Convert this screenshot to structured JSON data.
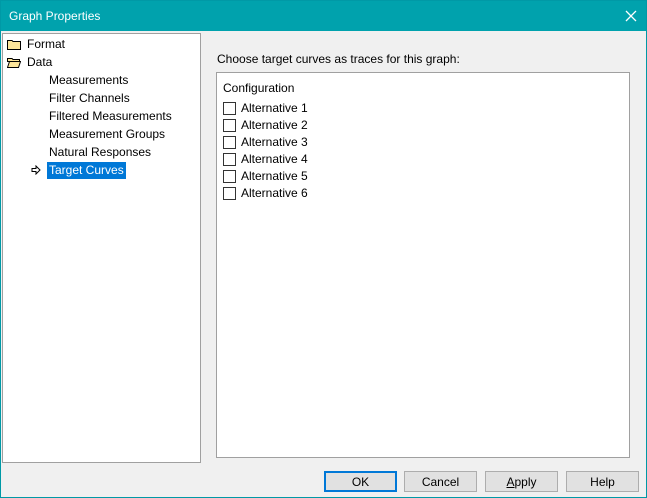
{
  "window": {
    "title": "Graph Properties",
    "accent_color": "#00a2ad"
  },
  "tree": {
    "root_items": [
      {
        "label": "Format",
        "icon": "folder-icon"
      },
      {
        "label": "Data",
        "icon": "folder-open-icon"
      }
    ],
    "children": [
      {
        "label": "Measurements"
      },
      {
        "label": "Filter Channels"
      },
      {
        "label": "Filtered Measurements"
      },
      {
        "label": "Measurement Groups"
      },
      {
        "label": "Natural Responses"
      },
      {
        "label": "Target Curves",
        "selected": true
      }
    ],
    "selection_color": "#0078d7"
  },
  "main": {
    "prompt": "Choose target curves as traces for this graph:",
    "panel_header": "Configuration",
    "options": [
      {
        "label": "Alternative 1",
        "checked": false
      },
      {
        "label": "Alternative 2",
        "checked": false
      },
      {
        "label": "Alternative 3",
        "checked": false
      },
      {
        "label": "Alternative 4",
        "checked": false
      },
      {
        "label": "Alternative 5",
        "checked": false
      },
      {
        "label": "Alternative 6",
        "checked": false
      }
    ]
  },
  "buttons": {
    "ok": "OK",
    "cancel": "Cancel",
    "apply_accel": "A",
    "apply_rest": "pply",
    "help": "Help"
  }
}
